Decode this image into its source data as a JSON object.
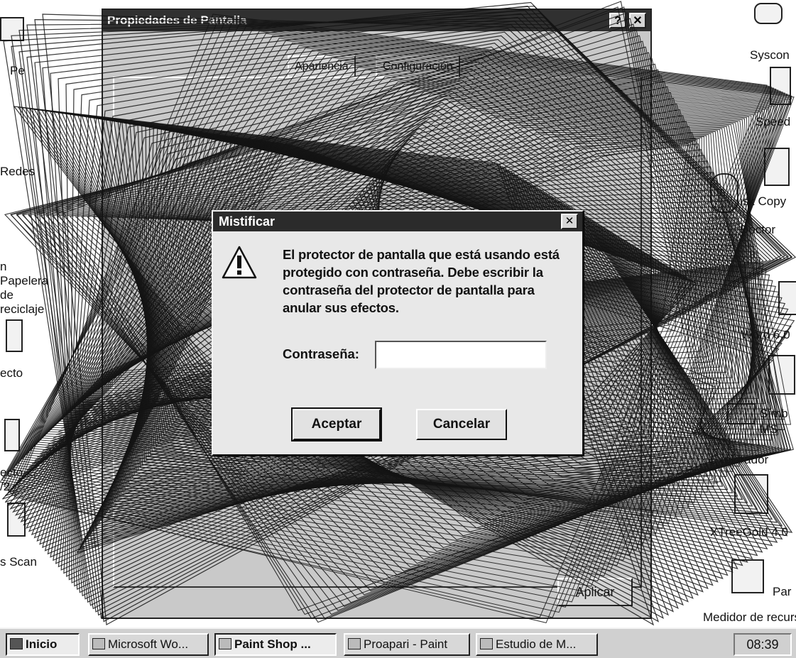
{
  "background_window": {
    "title": "Propiedades de Pantalla",
    "tab_label": "Configuración",
    "tab_partial": "Apariencia",
    "button_label": "Aplicar",
    "control_help": "?",
    "control_close": "✕"
  },
  "desktop_icons": {
    "left": [
      "Pe",
      "Redes",
      "n Papelera de reciclaje",
      "ecto",
      "ecto ... /2",
      "s Scan"
    ],
    "right": [
      "Syscon",
      "Speed",
      "isk Copy",
      "Doctor",
      "Word 6.0",
      "Símb MS-",
      "Explorador",
      "XTreeGold 4.0",
      "Par",
      "Medidor de recursos"
    ]
  },
  "dialog": {
    "title": "Mistificar",
    "close_glyph": "✕",
    "message": "El protector de pantalla que está usando está protegido con contraseña. Debe escribir la contraseña del protector de pantalla para anular sus efectos.",
    "password_label": "Contraseña:",
    "password_value": "",
    "ok_label": "Aceptar",
    "cancel_label": "Cancelar"
  },
  "taskbar": {
    "start_label": "Inicio",
    "items": [
      "Microsoft Wo...",
      "Paint Shop ...",
      "Proapari - Paint",
      "Estudio de M..."
    ],
    "clock": "08:39"
  },
  "colors": {
    "titlebar": "#2b2b2b",
    "dialog_face": "#e8e8e8",
    "mystify_lines": "#141414"
  }
}
